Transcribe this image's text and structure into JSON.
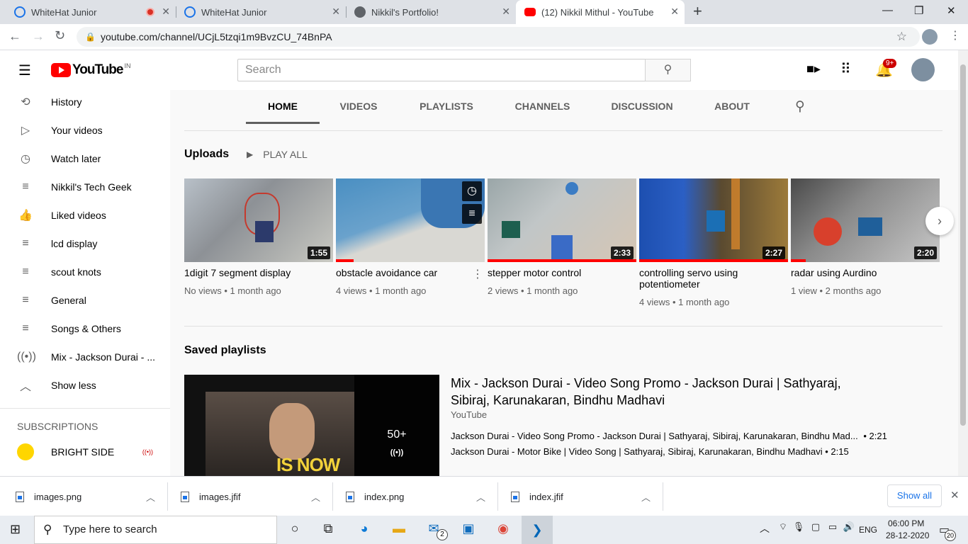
{
  "browser": {
    "tabs": [
      {
        "title": "WhiteHat Junior",
        "fav": "#1a73e8"
      },
      {
        "title": "WhiteHat Junior",
        "fav": "#1a73e8"
      },
      {
        "title": "Nikkil's Portfolio!",
        "fav": "#5f6368"
      },
      {
        "title": "(12) Nikkil Mithul - YouTube",
        "fav": "#ff0000"
      }
    ],
    "new_tab": "+",
    "url": "youtube.com/channel/UCjL5tzqi1m9BvzCU_74BnPA"
  },
  "youtube": {
    "logo_text": "YouTube",
    "country": "IN",
    "search_placeholder": "Search",
    "notification_count": "9+"
  },
  "sidebar": {
    "items": [
      {
        "label": "History",
        "icon": "history-icon"
      },
      {
        "label": "Your videos",
        "icon": "play-square-icon"
      },
      {
        "label": "Watch later",
        "icon": "clock-icon"
      },
      {
        "label": "Nikkil's Tech Geek",
        "icon": "playlist-icon"
      },
      {
        "label": "Liked videos",
        "icon": "thumbs-up-icon"
      },
      {
        "label": "lcd display",
        "icon": "playlist-icon"
      },
      {
        "label": "scout knots",
        "icon": "playlist-icon"
      },
      {
        "label": "General",
        "icon": "playlist-icon"
      },
      {
        "label": "Songs & Others",
        "icon": "playlist-icon"
      },
      {
        "label": "Mix - Jackson Durai - ...",
        "icon": "mix-icon"
      },
      {
        "label": "Show less",
        "icon": "chevron-up-icon"
      }
    ],
    "subscriptions_heading": "SUBSCRIPTIONS",
    "subscriptions": [
      {
        "label": "BRIGHT SIDE"
      }
    ]
  },
  "channel_tabs": [
    "HOME",
    "VIDEOS",
    "PLAYLISTS",
    "CHANNELS",
    "DISCUSSION",
    "ABOUT"
  ],
  "uploads": {
    "heading": "Uploads",
    "play_all": "PLAY ALL",
    "videos": [
      {
        "title": "1digit 7 segment display",
        "meta": "No views • 1 month ago",
        "duration": "1:55",
        "progress": 0
      },
      {
        "title": "obstacle avoidance car",
        "meta": "4 views • 1 month ago",
        "duration": "",
        "progress": 0.12
      },
      {
        "title": "stepper motor control",
        "meta": "2 views • 1 month ago",
        "duration": "2:33",
        "progress": 1
      },
      {
        "title": "controlling servo using potentiometer",
        "meta": "4 views • 1 month ago",
        "duration": "2:27",
        "progress": 1
      },
      {
        "title": "radar using Aurdino",
        "meta": "1 view • 2 months ago",
        "duration": "2:20",
        "progress": 0.1
      }
    ]
  },
  "saved_playlists": {
    "heading": "Saved playlists",
    "playlist": {
      "title": "Mix - Jackson Durai - Video Song Promo - Jackson Durai | Sathyaraj, Sibiraj, Karunakaran, Bindhu Madhavi",
      "channel": "YouTube",
      "count": "50+",
      "thumb_text": "IS NOW",
      "entries": [
        {
          "title": "Jackson Durai - Video Song Promo - Jackson Durai | Sathyaraj, Sibiraj, Karunakaran, Bindhu Mad...",
          "duration": "• 2:21"
        },
        {
          "title": "Jackson Durai - Motor Bike | Video Song | Sathyaraj, Sibiraj, Karunakaran, Bindhu Madhavi",
          "duration": "• 2:15"
        }
      ]
    }
  },
  "downloads": {
    "files": [
      "images.png",
      "images.jfif",
      "index.png",
      "index.jfif"
    ],
    "show_all": "Show all"
  },
  "taskbar": {
    "search_placeholder": "Type here to search",
    "language": "ENG",
    "time": "06:00 PM",
    "date": "28-12-2020",
    "mail_count": "2",
    "notif_count": "20"
  }
}
